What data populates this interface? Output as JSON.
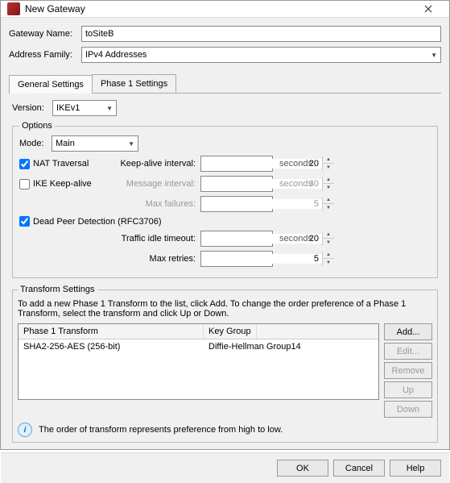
{
  "window": {
    "title": "New Gateway"
  },
  "form": {
    "name_label": "Gateway Name:",
    "name_value": "toSiteB",
    "family_label": "Address Family:",
    "family_value": "IPv4 Addresses"
  },
  "tabs": {
    "general": "General Settings",
    "phase1": "Phase 1 Settings"
  },
  "version": {
    "label": "Version:",
    "value": "IKEv1"
  },
  "options": {
    "legend": "Options",
    "mode_label": "Mode:",
    "mode_value": "Main",
    "nat_label": "NAT Traversal",
    "nat_checked": true,
    "keepalive_interval_label": "Keep-alive interval:",
    "keepalive_interval_value": "20",
    "seconds": "seconds",
    "ike_label": "IKE Keep-alive",
    "ike_checked": false,
    "message_interval_label": "Message interval:",
    "message_interval_value": "30",
    "max_failures_label": "Max failures:",
    "max_failures_value": "5",
    "dpd_label": "Dead Peer Detection (RFC3706)",
    "dpd_checked": true,
    "traffic_idle_label": "Traffic idle timeout:",
    "traffic_idle_value": "20",
    "max_retries_label": "Max retries:",
    "max_retries_value": "5"
  },
  "transform": {
    "legend": "Transform Settings",
    "desc": "To add a new Phase 1 Transform to the list, click Add. To change the order preference of a Phase 1 Transform, select the transform and click Up or Down.",
    "col1": "Phase 1 Transform",
    "col2": "Key Group",
    "rows": [
      {
        "c1": "SHA2-256-AES (256-bit)",
        "c2": "Diffie-Hellman Group14"
      }
    ],
    "buttons": {
      "add": "Add...",
      "edit": "Edit...",
      "remove": "Remove",
      "up": "Up",
      "down": "Down"
    },
    "info": "The order of transform represents preference from high to low."
  },
  "footer": {
    "ok": "OK",
    "cancel": "Cancel",
    "help": "Help"
  }
}
